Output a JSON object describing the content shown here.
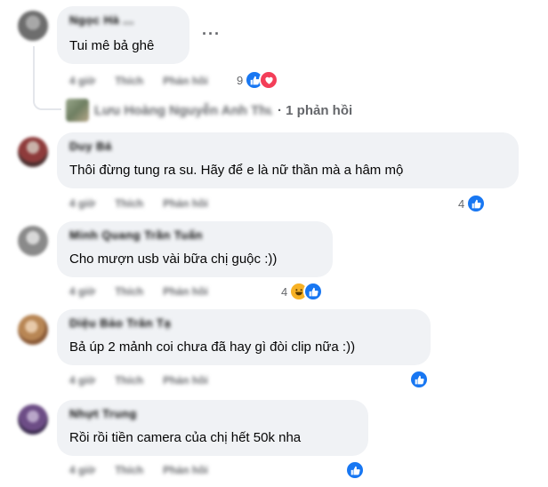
{
  "comments": [
    {
      "author": "Ngọc Hà ...",
      "text": "Tui mê bả ghê",
      "actions": [
        "4 giờ",
        "Thích",
        "Phản hồi"
      ],
      "reaction_count": "9",
      "more_label": "···",
      "replies": {
        "author": "Lưu Hoàng Nguyễn Anh Thư",
        "label": "· 1 phản hồi"
      }
    },
    {
      "author": "Duy Bá",
      "text": "Thôi đừng tung ra su. Hãy để e là nữ thần mà a hâm mộ",
      "actions": [
        "4 giờ",
        "Thích",
        "Phản hồi"
      ],
      "reaction_count": "4"
    },
    {
      "author": "Minh Quang Trần Tuấn",
      "text": "Cho mượn usb vài bữa chị guộc :))",
      "actions": [
        "4 giờ",
        "Thích",
        "Phản hồi"
      ],
      "reaction_count": "4"
    },
    {
      "author": "Diệu Bảo Trân Tạ",
      "text": "Bả úp 2 mảnh coi chưa đã hay gì đòi clip nữa :))",
      "actions": [
        "4 giờ",
        "Thích",
        "Phản hồi"
      ],
      "reaction_count": ""
    },
    {
      "author": "Nhựt Trung",
      "text": "Rồi rồi tiền camera của chị hết 50k nha",
      "actions": [
        "4 giờ",
        "Thích",
        "Phản hồi"
      ],
      "reaction_count": ""
    }
  ],
  "colors": {
    "bubble": "#f0f2f5",
    "like": "#1877f2",
    "love": "#f33e58",
    "haha": "#f7b125",
    "meta": "#65676b"
  }
}
